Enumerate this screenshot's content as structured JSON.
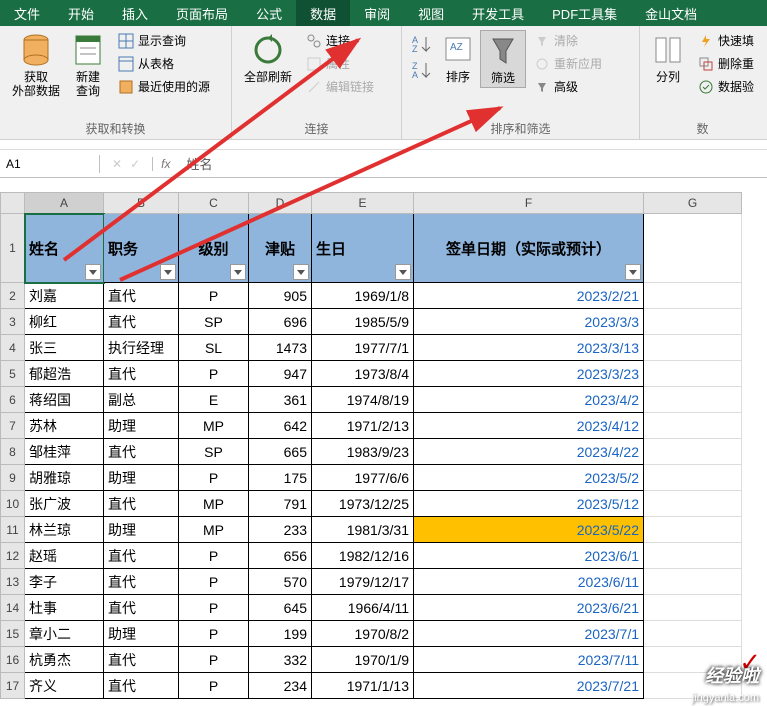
{
  "tabs": [
    "文件",
    "开始",
    "插入",
    "页面布局",
    "公式",
    "数据",
    "审阅",
    "视图",
    "开发工具",
    "PDF工具集",
    "金山文档"
  ],
  "activeTab": "数据",
  "ribbon": {
    "group1": {
      "label": "获取和转换",
      "bigBtn1": "获取\n外部数据",
      "bigBtn2": "新建\n查询",
      "small1": "显示查询",
      "small2": "从表格",
      "small3": "最近使用的源"
    },
    "group2": {
      "label": "连接",
      "bigBtn": "全部刷新",
      "small1": "连接",
      "small2": "属性",
      "small3": "编辑链接"
    },
    "group3": {
      "label": "排序和筛选",
      "btnSort": "排序",
      "btnFilter": "筛选",
      "small1": "清除",
      "small2": "重新应用",
      "small3": "高级"
    },
    "group4": {
      "label": "数",
      "btn": "分列",
      "small1": "快速填",
      "small2": "删除重",
      "small3": "数据验"
    }
  },
  "nameBox": "A1",
  "formula": "姓名",
  "columns": [
    "A",
    "B",
    "C",
    "D",
    "E",
    "F",
    "G"
  ],
  "headers": {
    "A": "姓名",
    "B": "职务",
    "C": "级别",
    "D": "津贴",
    "E": "生日",
    "F": "签单日期（实际或预计）"
  },
  "rows": [
    {
      "r": 2,
      "a": "刘嘉",
      "b": "直代",
      "c": "P",
      "d": "905",
      "e": "1969/1/8",
      "f": "2023/2/21"
    },
    {
      "r": 3,
      "a": "柳红",
      "b": "直代",
      "c": "SP",
      "d": "696",
      "e": "1985/5/9",
      "f": "2023/3/3"
    },
    {
      "r": 4,
      "a": "张三",
      "b": "执行经理",
      "c": "SL",
      "d": "1473",
      "e": "1977/7/1",
      "f": "2023/3/13"
    },
    {
      "r": 5,
      "a": "郁超浩",
      "b": "直代",
      "c": "P",
      "d": "947",
      "e": "1973/8/4",
      "f": "2023/3/23"
    },
    {
      "r": 6,
      "a": "蒋绍国",
      "b": "副总",
      "c": "E",
      "d": "361",
      "e": "1974/8/19",
      "f": "2023/4/2"
    },
    {
      "r": 7,
      "a": "苏林",
      "b": "助理",
      "c": "MP",
      "d": "642",
      "e": "1971/2/13",
      "f": "2023/4/12"
    },
    {
      "r": 8,
      "a": "邹桂萍",
      "b": "直代",
      "c": "SP",
      "d": "665",
      "e": "1983/9/23",
      "f": "2023/4/22"
    },
    {
      "r": 9,
      "a": "胡雅琼",
      "b": "助理",
      "c": "P",
      "d": "175",
      "e": "1977/6/6",
      "f": "2023/5/2"
    },
    {
      "r": 10,
      "a": "张广波",
      "b": "直代",
      "c": "MP",
      "d": "791",
      "e": "1973/12/25",
      "f": "2023/5/12"
    },
    {
      "r": 11,
      "a": "林兰琼",
      "b": "助理",
      "c": "MP",
      "d": "233",
      "e": "1981/3/31",
      "f": "2023/5/22",
      "hl": true
    },
    {
      "r": 12,
      "a": "赵瑶",
      "b": "直代",
      "c": "P",
      "d": "656",
      "e": "1982/12/16",
      "f": "2023/6/1"
    },
    {
      "r": 13,
      "a": "李子",
      "b": "直代",
      "c": "P",
      "d": "570",
      "e": "1979/12/17",
      "f": "2023/6/11"
    },
    {
      "r": 14,
      "a": "杜事",
      "b": "直代",
      "c": "P",
      "d": "645",
      "e": "1966/4/11",
      "f": "2023/6/21"
    },
    {
      "r": 15,
      "a": "章小二",
      "b": "助理",
      "c": "P",
      "d": "199",
      "e": "1970/8/2",
      "f": "2023/7/1"
    },
    {
      "r": 16,
      "a": "杭勇杰",
      "b": "直代",
      "c": "P",
      "d": "332",
      "e": "1970/1/9",
      "f": "2023/7/11"
    },
    {
      "r": 17,
      "a": "齐义",
      "b": "直代",
      "c": "P",
      "d": "234",
      "e": "1971/1/13",
      "f": "2023/7/21"
    }
  ],
  "watermark": "经验啦",
  "watermarkUrl": "jingyanla.com",
  "check": "✓"
}
